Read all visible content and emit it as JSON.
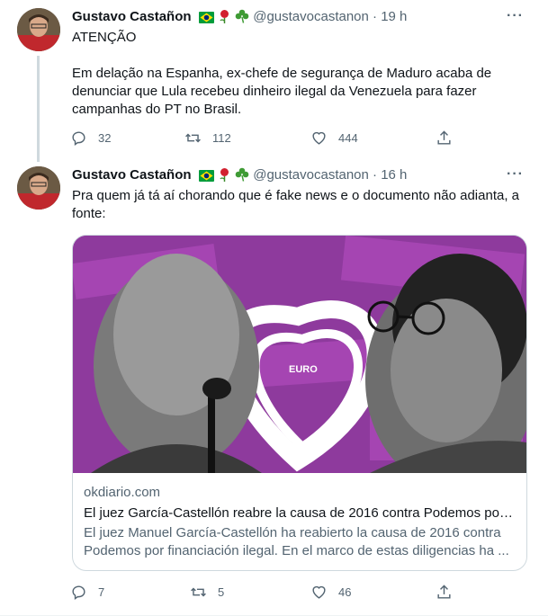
{
  "tweets": [
    {
      "author_name": "Gustavo Castañon",
      "handle": "@gustavocastanon",
      "time": "· 19 h",
      "text_lines": [
        "ATENÇÃO",
        "",
        "Em delação na Espanha, ex-chefe de segurança de Maduro acaba de denunciar que Lula recebeu dinheiro ilegal da Venezuela para fazer campanhas do PT no Brasil."
      ],
      "replies": "32",
      "retweets": "112",
      "likes": "444"
    },
    {
      "author_name": "Gustavo Castañon",
      "handle": "@gustavocastanon",
      "time": "· 16 h",
      "text": "Pra quem já tá aí chorando que é fake news e o documento não adianta, a fonte:",
      "card": {
        "domain": "okdiario.com",
        "title": "El juez García-Castellón reabre la causa de 2016 contra Podemos por ...",
        "description": "El juez Manuel García-Castellón ha reabierto la causa de 2016 contra Podemos por financiación ilegal. En el marco de estas diligencias ha ...",
        "image_text": "EURO"
      },
      "replies": "7",
      "retweets": "5",
      "likes": "46"
    }
  ],
  "icons": {
    "flag": "brazil-flag-icon",
    "rose": "rose-icon",
    "shamrock": "shamrock-icon",
    "more": "more-icon",
    "reply": "reply-icon",
    "retweet": "retweet-icon",
    "like": "heart-icon",
    "share": "share-icon"
  },
  "colors": {
    "text": "#0f1419",
    "secondary": "#536471",
    "border": "#cfd9de",
    "card_image_bg": "#9b3fa8"
  }
}
